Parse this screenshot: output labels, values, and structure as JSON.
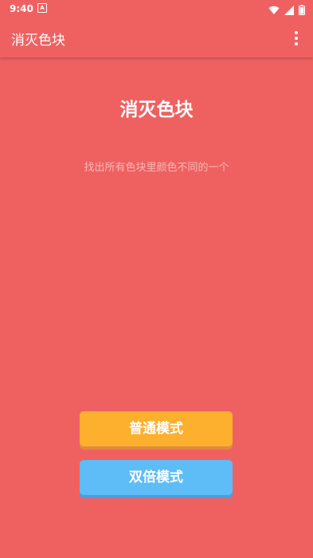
{
  "status_bar": {
    "time": "9:40",
    "a_badge": "A",
    "wifi_icon": "wifi-icon",
    "cell_icon": "cell-signal-icon",
    "battery_icon": "battery-icon"
  },
  "app_bar": {
    "title": "消灭色块",
    "overflow_icon": "more-vert-icon"
  },
  "main": {
    "title": "消灭色块",
    "subtitle": "找出所有色块里颜色不同的一个"
  },
  "buttons": {
    "normal_mode": "普通模式",
    "double_mode": "双倍模式"
  },
  "colors": {
    "background": "#ef6161",
    "normal_button": "#fcb02e",
    "double_button": "#5ebcf6"
  }
}
